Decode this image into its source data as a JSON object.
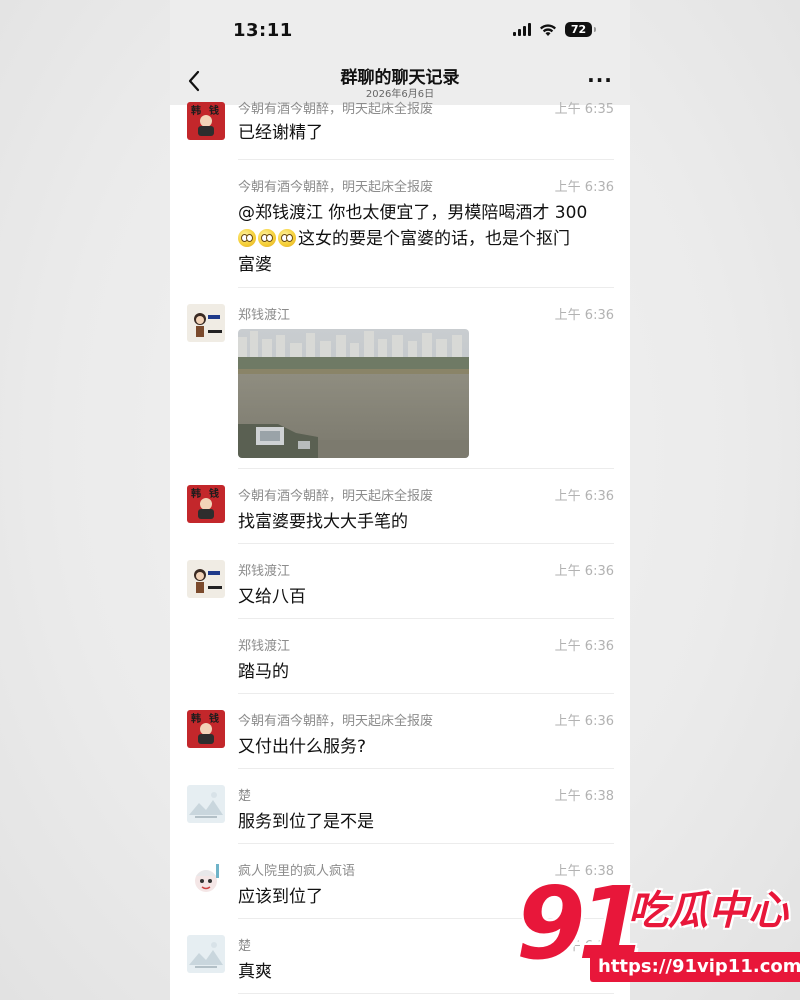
{
  "status_bar": {
    "time": "13:11",
    "battery": "72"
  },
  "header": {
    "title": "群聊的聊天记录",
    "subtitle": "2026年6月6日"
  },
  "messages": [
    {
      "sender": "今朝有酒今朝醉，明天起床全报废",
      "time": "上午 6:35",
      "text": "已经谢精了",
      "avatar": "red-avatar"
    },
    {
      "sender": "今朝有酒今朝醉，明天起床全报废",
      "time": "上午 6:36",
      "text_line1": "@郑钱渡江 你也太便宜了，男模陪喝酒才 300",
      "text_line2": "这女的要是个富婆的话，也是个抠门",
      "text_line3": "富婆",
      "avatar": "none"
    },
    {
      "sender": "郑钱渡江",
      "time": "上午 6:36",
      "image": "river-city-photo",
      "avatar": "cartoon-avatar"
    },
    {
      "sender": "今朝有酒今朝醉，明天起床全报废",
      "time": "上午 6:36",
      "text": "找富婆要找大大手笔的",
      "avatar": "red-avatar"
    },
    {
      "sender": "郑钱渡江",
      "time": "上午 6:36",
      "text": "又给八百",
      "avatar": "cartoon-avatar"
    },
    {
      "sender": "郑钱渡江",
      "time": "上午 6:36",
      "text": "踏马的",
      "avatar": "none"
    },
    {
      "sender": "今朝有酒今朝醉，明天起床全报废",
      "time": "上午 6:36",
      "text": "又付出什么服务?",
      "avatar": "red-avatar"
    },
    {
      "sender": "楚",
      "time": "上午 6:38",
      "text": "服务到位了是不是",
      "avatar": "landscape-avatar"
    },
    {
      "sender": "疯人院里的疯人疯语",
      "time": "上午 6:38",
      "text": "应该到位了",
      "avatar": "doll-avatar"
    },
    {
      "sender": "楚",
      "time": "上午 6:38",
      "text": "真爽",
      "avatar": "landscape-avatar"
    }
  ],
  "watermark": {
    "number": "91",
    "text": "吃瓜中心",
    "url": "https://91vip11.com"
  },
  "colors": {
    "header_bg": "#ededed",
    "chat_bg": "#ffffff",
    "sender_gray": "#8c8c8c",
    "watermark_red": "#e8173a"
  }
}
